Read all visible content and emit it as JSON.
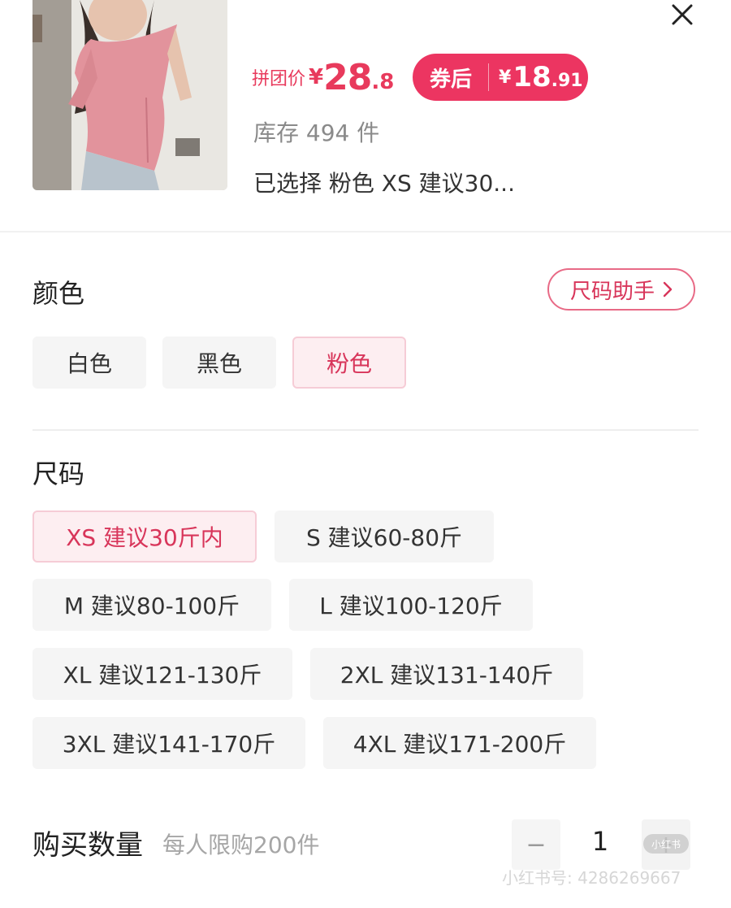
{
  "product": {
    "price_label": "拼团价",
    "price_currency": "¥",
    "price_int": "28",
    "price_dec": ".8",
    "coupon_label": "券后",
    "coupon_currency": "¥",
    "coupon_int": "18",
    "coupon_dec": ".91",
    "stock": "库存 494 件",
    "selected": "已选择  粉色 XS 建议30..."
  },
  "color": {
    "title": "颜色",
    "helper_label": "尺码助手",
    "options": [
      "白色",
      "黑色",
      "粉色"
    ],
    "selected_index": 2
  },
  "size": {
    "title": "尺码",
    "options": [
      "XS 建议30斤内",
      "S 建议60-80斤",
      "M 建议80-100斤",
      "L 建议100-120斤",
      "XL 建议121-130斤",
      "2XL 建议131-140斤",
      "3XL 建议141-170斤",
      "4XL 建议171-200斤"
    ],
    "selected_index": 0
  },
  "quantity": {
    "label": "购买数量",
    "limit": "每人限购200件",
    "minus": "−",
    "value": "1",
    "plus": "+"
  },
  "watermark": {
    "badge": "小红书",
    "text": "小红书号: 4286269667"
  },
  "colors": {
    "accent": "#ec3561",
    "accent_text": "#d8355a",
    "chip_bg": "#f5f5f5",
    "chip_active_bg": "#fdeef1"
  }
}
